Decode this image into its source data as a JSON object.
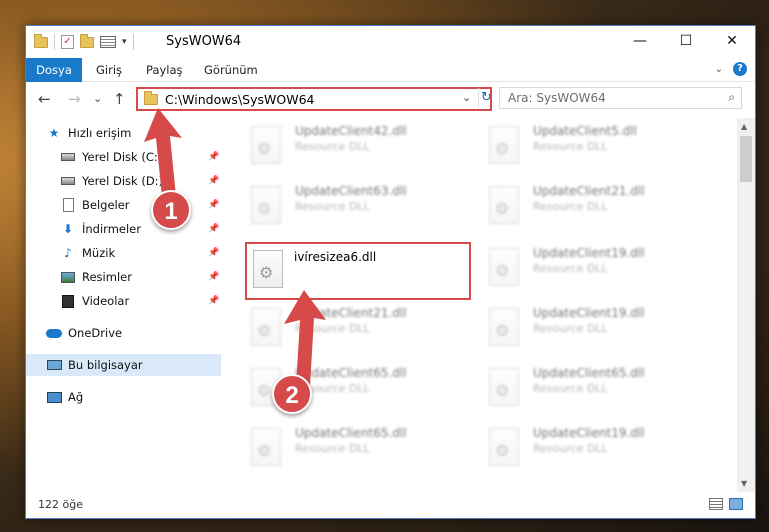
{
  "window": {
    "title": "SysWOW64",
    "minimize": "—",
    "maximize": "☐",
    "close": "✕"
  },
  "ribbon": {
    "tabs": [
      "Dosya",
      "Giriş",
      "Paylaş",
      "Görünüm"
    ],
    "help": "?"
  },
  "nav": {
    "back": "←",
    "forward": "→",
    "recent": "⌄",
    "up": "↑",
    "address": "C:\\Windows\\SysWOW64",
    "search_placeholder": "Ara: SysWOW64"
  },
  "sidebar": {
    "items": [
      {
        "label": "Hızlı erişim",
        "icon": "star-icon"
      },
      {
        "label": "Yerel Disk (C:)",
        "icon": "disk-icon"
      },
      {
        "label": "Yerel Disk (D:)",
        "icon": "disk-icon"
      },
      {
        "label": "Belgeler",
        "icon": "document-icon"
      },
      {
        "label": "İndirmeler",
        "icon": "download-icon"
      },
      {
        "label": "Müzik",
        "icon": "music-icon"
      },
      {
        "label": "Resimler",
        "icon": "picture-icon"
      },
      {
        "label": "Videolar",
        "icon": "video-icon"
      },
      {
        "label": "OneDrive",
        "icon": "cloud-icon"
      },
      {
        "label": "Bu bilgisayar",
        "icon": "computer-icon"
      },
      {
        "label": "Ağ",
        "icon": "network-icon"
      }
    ]
  },
  "files": {
    "left": [
      {
        "name": "UpdateClient42.dll",
        "desc": "Resource DLL"
      },
      {
        "name": "UpdateClient63.dll",
        "desc": "Resource DLL"
      },
      {
        "name": "ivíresizea6.dll",
        "desc": ""
      },
      {
        "name": "UpdateClient21.dll",
        "desc": "Resource DLL"
      },
      {
        "name": "UpdateClient65.dll",
        "desc": "Resource DLL"
      },
      {
        "name": "UpdateClient65.dll",
        "desc": "Resource DLL"
      }
    ],
    "right": [
      {
        "name": "UpdateClient5.dll",
        "desc": "Resource DLL"
      },
      {
        "name": "UpdateClient21.dll",
        "desc": "Resource DLL"
      },
      {
        "name": "UpdateClient19.dll",
        "desc": "Resource DLL"
      },
      {
        "name": "UpdateClient19.dll",
        "desc": "Resource DLL"
      },
      {
        "name": "UpdateClient65.dll",
        "desc": "Resource DLL"
      },
      {
        "name": "UpdateClient19.dll",
        "desc": "Resource DLL"
      }
    ]
  },
  "status": {
    "count": "122 öğe"
  },
  "annotations": {
    "badge1": "1",
    "badge2": "2",
    "color": "#d64a4a"
  }
}
